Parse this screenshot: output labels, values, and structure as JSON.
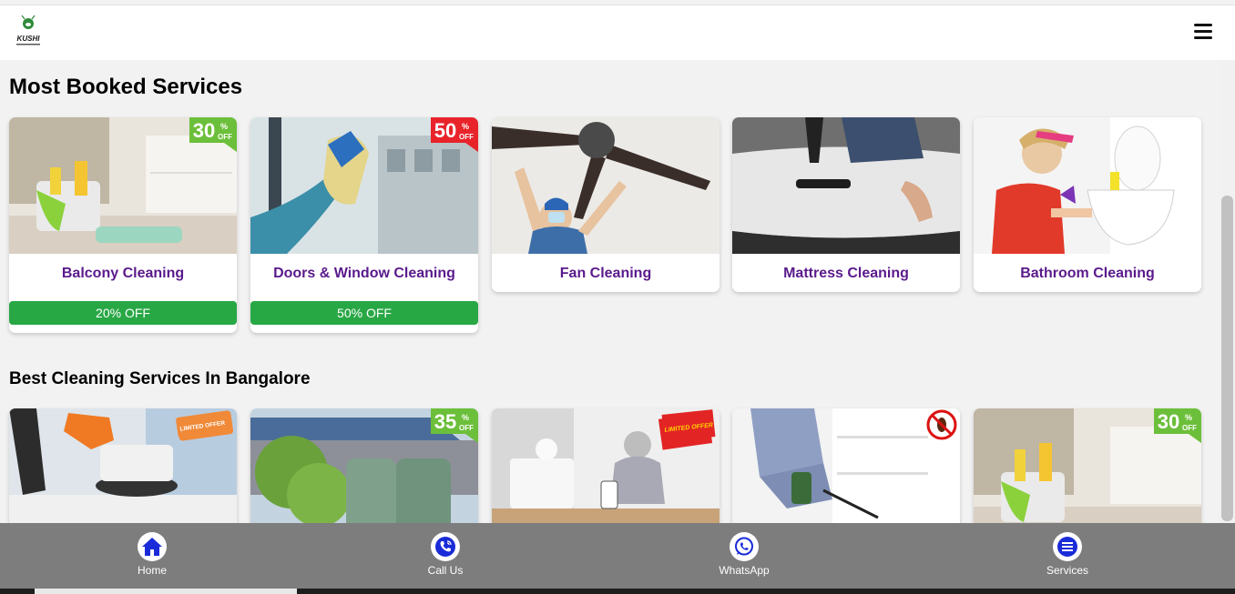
{
  "brand": {
    "logo_text": "KUSHI"
  },
  "sections": {
    "most_booked": {
      "title": "Most Booked Services",
      "cards": [
        {
          "name": "Balcony Cleaning",
          "offer": "20% OFF",
          "ribbon": "30",
          "ribbon_color": "#6cbf3a"
        },
        {
          "name": "Doors & Window Cleaning",
          "offer": "50% OFF",
          "ribbon": "50",
          "ribbon_color": "#e8242a"
        },
        {
          "name": "Fan Cleaning"
        },
        {
          "name": "Mattress Cleaning"
        },
        {
          "name": "Bathroom Cleaning"
        }
      ]
    },
    "best_cleaning": {
      "title": "Best Cleaning Services In Bangalore",
      "cards": [
        {
          "badge": "LIMITED OFFER"
        },
        {
          "ribbon": "35",
          "ribbon_color": "#6cbf3a"
        },
        {
          "badge": "LIMITED OFFER"
        },
        {
          "badge": "no-bugs"
        },
        {
          "ribbon": "30",
          "ribbon_color": "#6cbf3a"
        }
      ]
    }
  },
  "ribbon_suffix": {
    "pct": "%",
    "off": "OFF"
  },
  "bottom_nav": [
    {
      "label": "Home",
      "icon": "home-icon"
    },
    {
      "label": "Call Us",
      "icon": "phone-icon"
    },
    {
      "label": "WhatsApp",
      "icon": "whatsapp-icon"
    },
    {
      "label": "Services",
      "icon": "menu-icon"
    }
  ],
  "colors": {
    "accent": "#5a1a8c",
    "offer_green": "#28a745",
    "nav_bar": "#7d7d7d",
    "nav_icon": "#1a2bd8"
  }
}
